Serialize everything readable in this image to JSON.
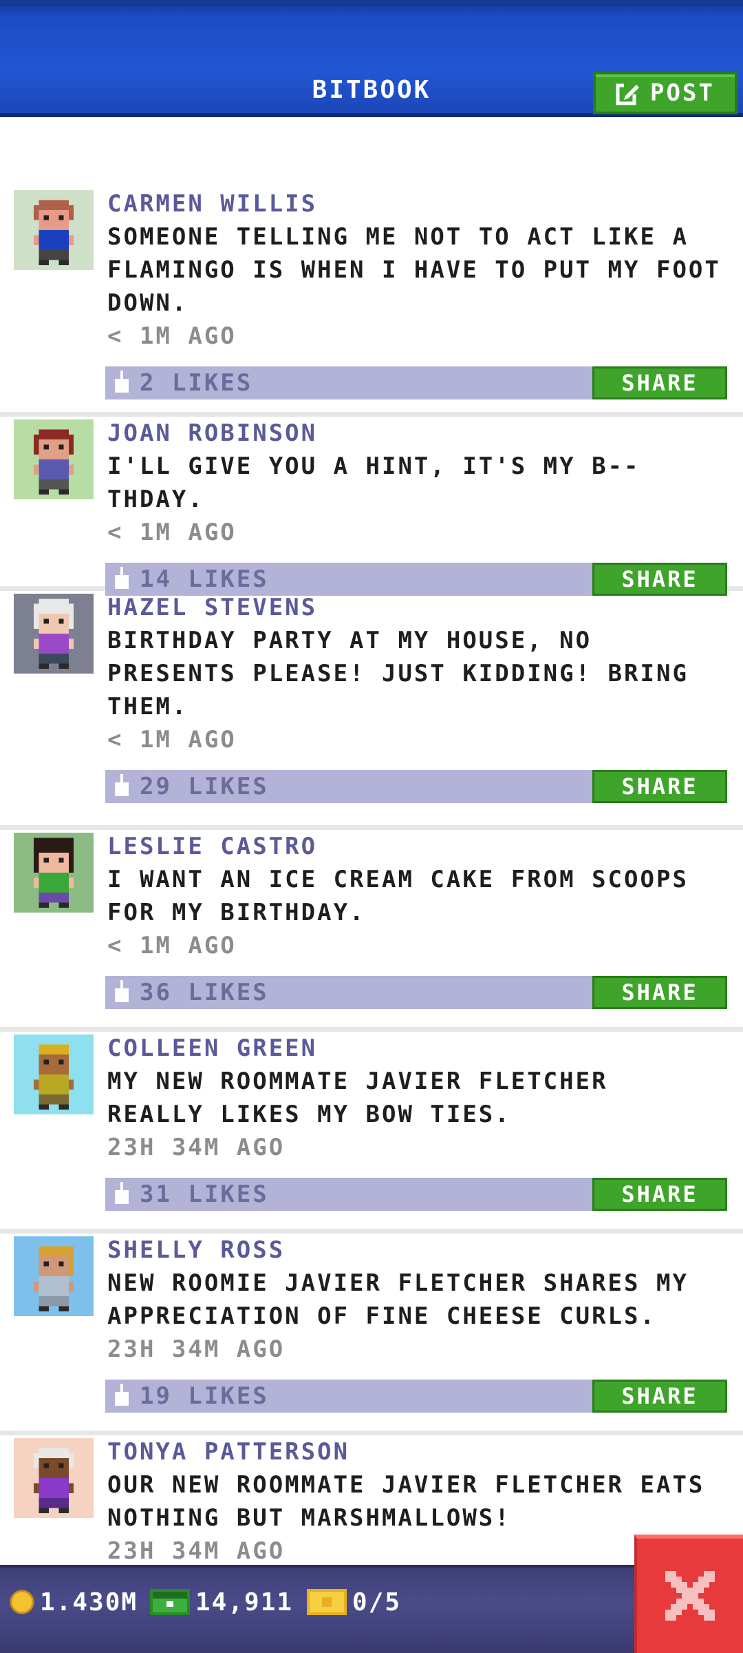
{
  "header": {
    "title": "BITBOOK",
    "post_label": "POST"
  },
  "posts": [
    {
      "author": "CARMEN WILLIS",
      "message": "SOMEONE TELLING ME NOT TO ACT LIKE A\nFLAMINGO IS WHEN I HAVE TO PUT MY FOOT\nDOWN.",
      "time": "< 1M AGO",
      "likes": "2 LIKES",
      "share": "SHARE",
      "avatar_bg": "#cfe0c8",
      "hair": "#b06048",
      "shirt": "#1a3fbf",
      "skin": "#e79b86"
    },
    {
      "author": "JOAN ROBINSON",
      "message": "I'LL GIVE YOU A HINT, IT'S MY B--THDAY.",
      "time": "< 1M AGO",
      "likes": "14 LIKES",
      "share": "SHARE",
      "avatar_bg": "#b7dda4",
      "hair": "#8a2a22",
      "shirt": "#5a5ab0",
      "skin": "#e0a088"
    },
    {
      "author": "HAZEL STEVENS",
      "message": "BIRTHDAY PARTY AT MY HOUSE, NO\nPRESENTS PLEASE! JUST KIDDING! BRING\nTHEM.",
      "time": "< 1M AGO",
      "likes": "29 LIKES",
      "share": "SHARE",
      "avatar_bg": "#7c8090",
      "hair": "#e8e8e8",
      "shirt": "#9a4ac8",
      "skin": "#f0c8b0"
    },
    {
      "author": "LESLIE CASTRO",
      "message": "I WANT AN ICE CREAM CAKE FROM SCOOPS\nFOR MY BIRTHDAY.",
      "time": "< 1M AGO",
      "likes": "36 LIKES",
      "share": "SHARE",
      "avatar_bg": "#8cbc84",
      "hair": "#2a1a16",
      "shirt": "#3aa838",
      "skin": "#f0b8a0"
    },
    {
      "author": "COLLEEN GREEN",
      "message": "MY NEW ROOMMATE JAVIER FLETCHER\nREALLY LIKES MY BOW TIES.",
      "time": "23H 34M AGO",
      "likes": "31 LIKES",
      "share": "SHARE",
      "avatar_bg": "#8ee0ee",
      "hair": "#d8b020",
      "shirt": "#b8a824",
      "skin": "#a86a3a"
    },
    {
      "author": "SHELLY ROSS",
      "message": "NEW ROOMIE JAVIER FLETCHER SHARES MY\nAPPRECIATION OF FINE CHEESE CURLS.",
      "time": "23H 34M AGO",
      "likes": "19 LIKES",
      "share": "SHARE",
      "avatar_bg": "#7ec0ec",
      "hair": "#d8a030",
      "shirt": "#b0c0d0",
      "skin": "#d09878"
    },
    {
      "author": "TONYA PATTERSON",
      "message": "OUR NEW ROOMMATE JAVIER FLETCHER EATS\nNOTHING BUT MARSHMALLOWS!",
      "time": "23H 34M AGO",
      "likes": "",
      "share": "",
      "avatar_bg": "#f6d2c0",
      "hair": "#e8e8e8",
      "shirt": "#8a3ac8",
      "skin": "#7a4a2a"
    }
  ],
  "bottom_bar": {
    "coins": "1.430M",
    "bux": "14,911",
    "tickets": "0/5"
  },
  "colors": {
    "header_blue": "#2356d4",
    "share_green": "#3ea42a",
    "likes_bar": "#b3b3d8",
    "close_red": "#e8393c"
  }
}
